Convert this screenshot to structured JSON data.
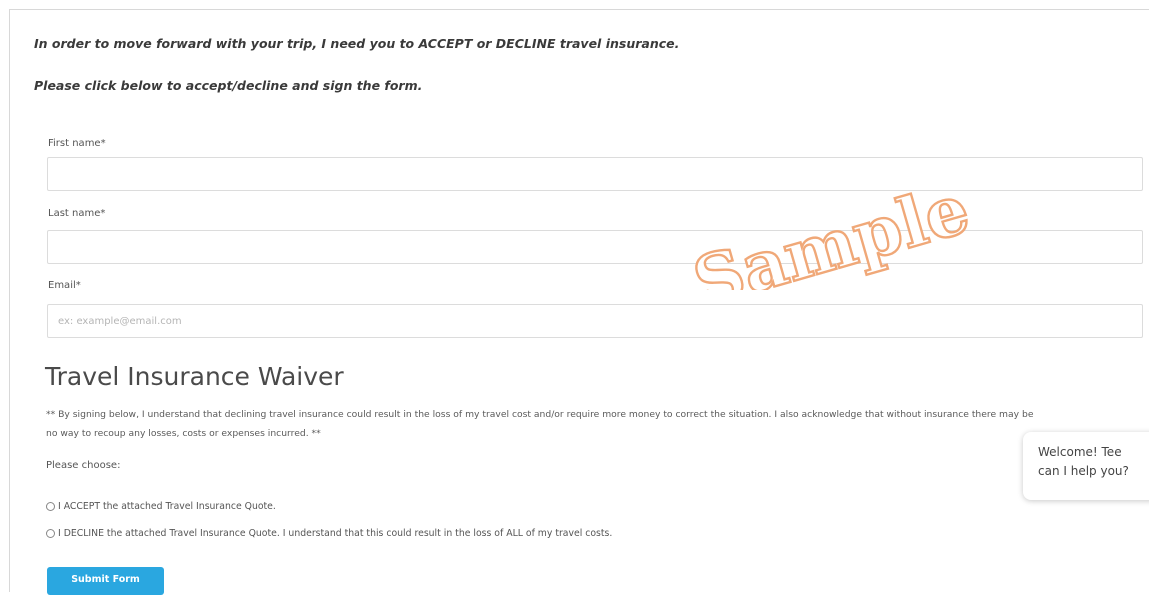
{
  "intro": {
    "line1": "In order to move forward with your trip, I need you to ACCEPT or DECLINE travel insurance.",
    "line2": "Please click below to accept/decline and sign the form."
  },
  "form": {
    "first_name": {
      "label": "First name*",
      "value": "",
      "placeholder": ""
    },
    "last_name": {
      "label": "Last name*",
      "value": "",
      "placeholder": ""
    },
    "email": {
      "label": "Email*",
      "value": "",
      "placeholder": "ex: example@email.com"
    }
  },
  "waiver": {
    "title": "Travel Insurance Waiver",
    "text": "** By signing below, I understand that declining travel insurance could result in the loss of my travel cost and/or require more money to correct the situation. I also acknowledge that without insurance there may be no way to recoup any losses, costs or expenses incurred. **",
    "choose_label": "Please choose:",
    "options": [
      {
        "label": "I ACCEPT the attached Travel Insurance Quote.",
        "selected": false
      },
      {
        "label": "I DECLINE the attached Travel Insurance Quote. I understand that this could result in the loss of ALL of my travel costs.",
        "selected": false
      }
    ]
  },
  "submit_label": "Submit Form",
  "chat": {
    "line1": "Welcome! Tee",
    "line2": "can I help you?"
  },
  "watermark": {
    "text": "Sample",
    "color": "#f0a878"
  },
  "colors": {
    "accent": "#2aa7e0"
  }
}
